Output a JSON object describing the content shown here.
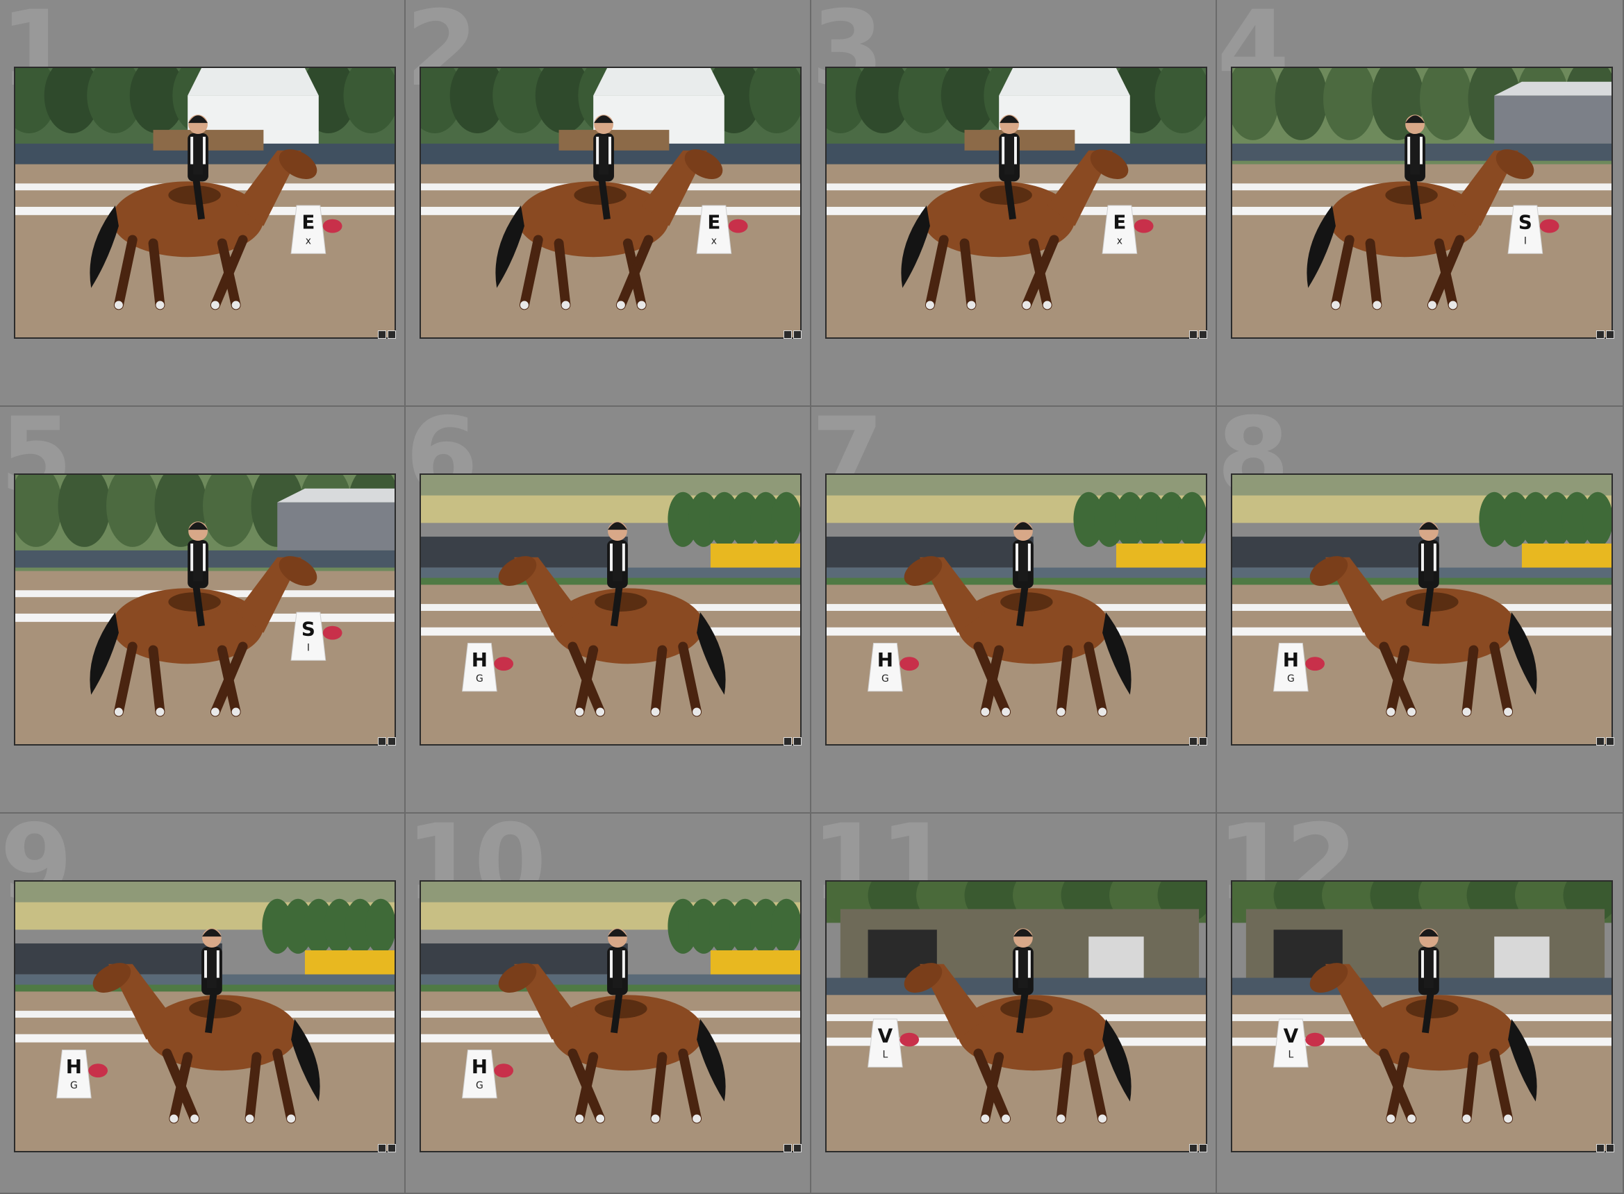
{
  "thumbnails": [
    {
      "index": "1",
      "scene": "tent",
      "facing": "right",
      "marker": "E",
      "marker_sub": "x"
    },
    {
      "index": "2",
      "scene": "tent",
      "facing": "right",
      "marker": "E",
      "marker_sub": "x"
    },
    {
      "index": "3",
      "scene": "tent",
      "facing": "right",
      "marker": "E",
      "marker_sub": "x"
    },
    {
      "index": "4",
      "scene": "trees",
      "facing": "right",
      "marker": "S",
      "marker_sub": "I"
    },
    {
      "index": "5",
      "scene": "trees",
      "facing": "right",
      "marker": "S",
      "marker_sub": "I"
    },
    {
      "index": "6",
      "scene": "field",
      "facing": "left",
      "marker": "H",
      "marker_sub": "G"
    },
    {
      "index": "7",
      "scene": "field",
      "facing": "left",
      "marker": "H",
      "marker_sub": "G"
    },
    {
      "index": "8",
      "scene": "field",
      "facing": "left",
      "marker": "H",
      "marker_sub": "G"
    },
    {
      "index": "9",
      "scene": "field",
      "facing": "left",
      "marker": "H",
      "marker_sub": "G"
    },
    {
      "index": "10",
      "scene": "field",
      "facing": "left",
      "marker": "H",
      "marker_sub": "G"
    },
    {
      "index": "11",
      "scene": "barn",
      "facing": "left",
      "marker": "V",
      "marker_sub": "L"
    },
    {
      "index": "12",
      "scene": "barn",
      "facing": "left",
      "marker": "V",
      "marker_sub": "L"
    }
  ],
  "colors": {
    "grid_background": "#8a8a8a",
    "cell_number": "#999999",
    "horse": "#8a4a22",
    "sand": "#a8927a",
    "rail": "#f2f2f2"
  },
  "icons": {
    "badge": "badge-icon"
  }
}
